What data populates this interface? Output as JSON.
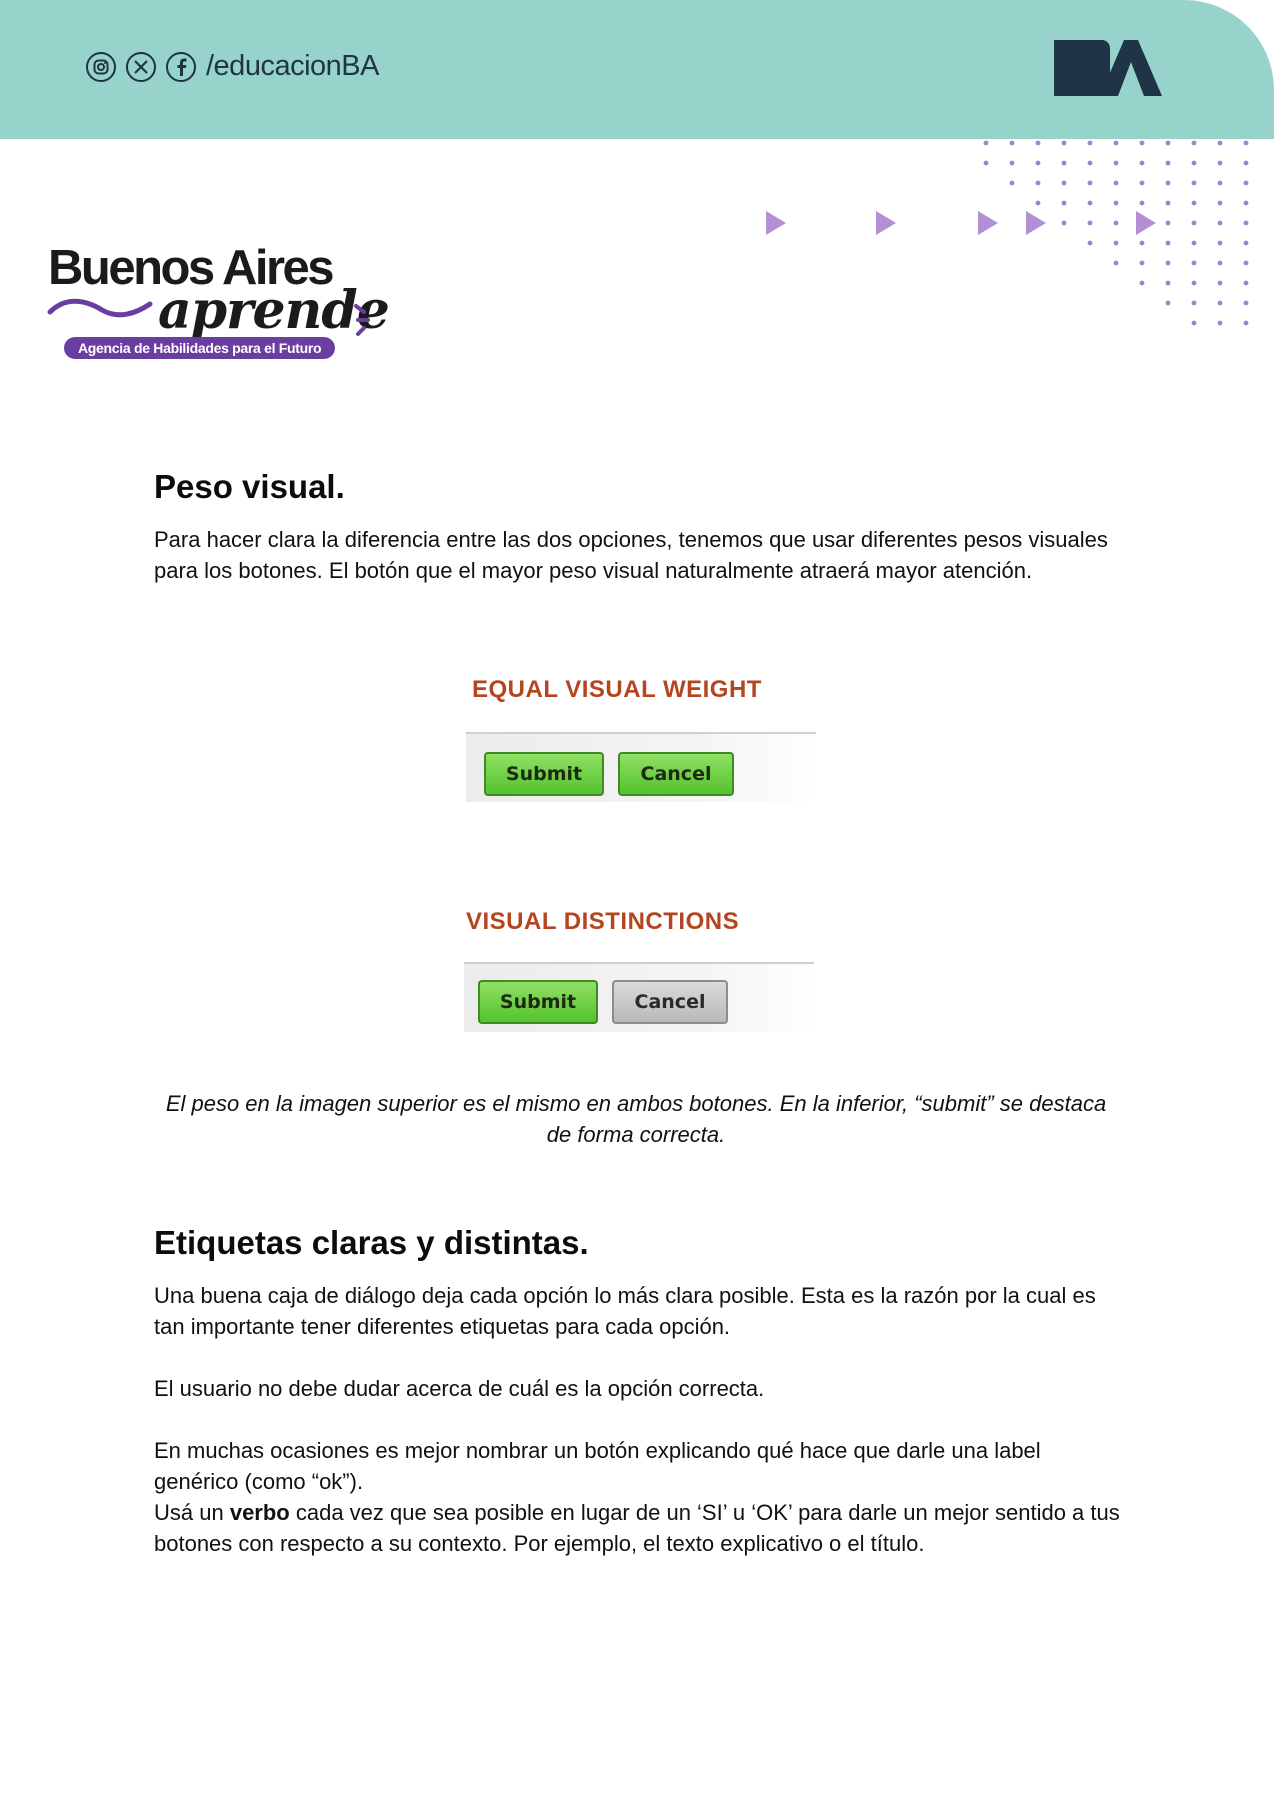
{
  "header": {
    "social_handle": "/educacionBA",
    "social_icons": [
      "instagram-icon",
      "x-icon",
      "facebook-icon"
    ],
    "logo_text": "BA",
    "band_color": "#97d3cb",
    "logo_color": "#1f3447"
  },
  "brand": {
    "name": "Buenos Aires",
    "script": "aprende",
    "tagline": "Agencia de Habilidades para el Futuro",
    "accent_color": "#6a3ea1"
  },
  "section1": {
    "title": "Peso visual.",
    "body": "Para hacer clara la diferencia entre las dos opciones, tenemos que usar diferentes pesos visuales para los botones. El botón que el mayor peso visual naturalmente atraerá mayor atención."
  },
  "figure": {
    "top_title": "EQUAL VISUAL WEIGHT",
    "top_submit": "Submit",
    "top_cancel": "Cancel",
    "bottom_title": "VISUAL DISTINCTIONS",
    "bottom_submit": "Submit",
    "bottom_cancel": "Cancel",
    "caption": "El peso en la imagen superior es el mismo en ambos botones. En la inferior, “submit” se destaca de forma correcta."
  },
  "section2": {
    "title": "Etiquetas claras y distintas.",
    "p1": "Una buena caja de diálogo deja cada opción lo más clara posible. Esta es la razón por la cual es tan importante tener diferentes etiquetas para cada opción.",
    "p2": "El usuario no debe dudar acerca de cuál es la opción correcta.",
    "p3": "En muchas ocasiones es mejor nombrar un botón explicando qué hace que darle una label genérico (como “ok”).",
    "p4_before": "Usá un ",
    "p4_bold": "verbo",
    "p4_after": " cada vez que sea posible en lugar de un ‘SI’ u ‘OK’ para darle un mejor sentido a tus botones con respecto a su contexto. Por ejemplo, el texto explicativo o el título."
  }
}
